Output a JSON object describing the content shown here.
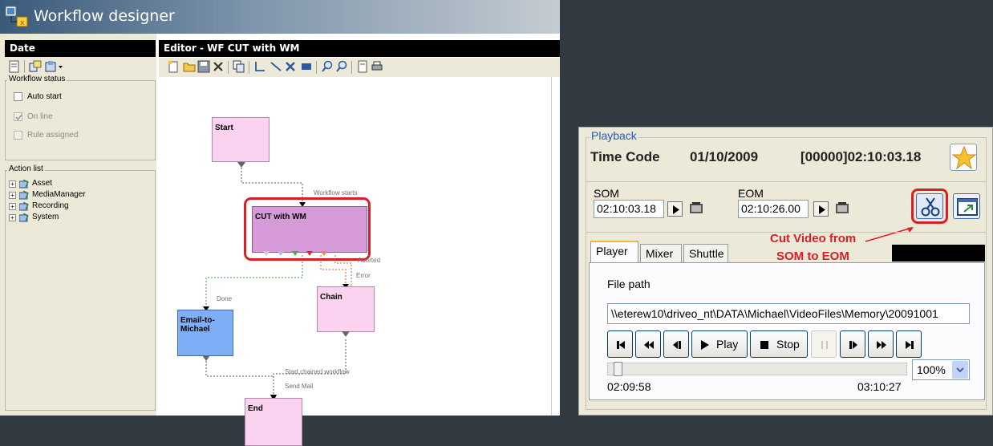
{
  "workflow_window": {
    "title": "Workflow designer",
    "left_panel": {
      "header": "Date",
      "status_group": {
        "label": "Workflow status",
        "items": [
          {
            "label": "Auto start",
            "checked": false,
            "disabled": false
          },
          {
            "label": "On line",
            "checked": true,
            "disabled": true
          },
          {
            "label": "Rule assigned",
            "checked": false,
            "disabled": true
          }
        ]
      },
      "action_group": {
        "label": "Action list",
        "items": [
          "Asset",
          "MediaManager",
          "Recording",
          "System"
        ]
      }
    },
    "editor": {
      "header": "Editor - WF CUT with WM",
      "nodes": {
        "start": "Start",
        "cut": "CUT with WM",
        "chain": "Chain",
        "email": "Email-to-Michael",
        "end": "End"
      },
      "edge_labels": {
        "workflow_starts": "Workflow starts",
        "aborted": "Aborted",
        "error": "Error",
        "done": "Done",
        "start_chained": "Start chained workflow",
        "send_mail": "Send Mail"
      },
      "colors": {
        "node_pink": "#fbd3f0",
        "node_violet": "#d69ad8",
        "node_blue": "#7eaef5",
        "highlight": "#d91f26"
      }
    }
  },
  "playback": {
    "legend": "Playback",
    "timecode_label": "Time Code",
    "date": "01/10/2009",
    "timecode": "[00000]02:10:03.18",
    "som_label": "SOM",
    "som_value": "02:10:03.18",
    "eom_label": "EOM",
    "eom_value": "02:10:26.00",
    "annotation": {
      "line1": "Cut Video from",
      "line2": "SOM to EOM",
      "color": "#d91f26"
    },
    "tabs": [
      "Player",
      "Mixer",
      "Shuttle"
    ],
    "file_path_label": "File path",
    "file_path": "\\\\eterew10\\driveo_nt\\DATA\\Michael\\VideoFiles\\Memory\\20091001",
    "transport": {
      "play": "Play",
      "stop": "Stop"
    },
    "slider_start": "02:09:58",
    "slider_end": "03:10:27",
    "slider_position": 0.02,
    "zoom": "100%"
  }
}
